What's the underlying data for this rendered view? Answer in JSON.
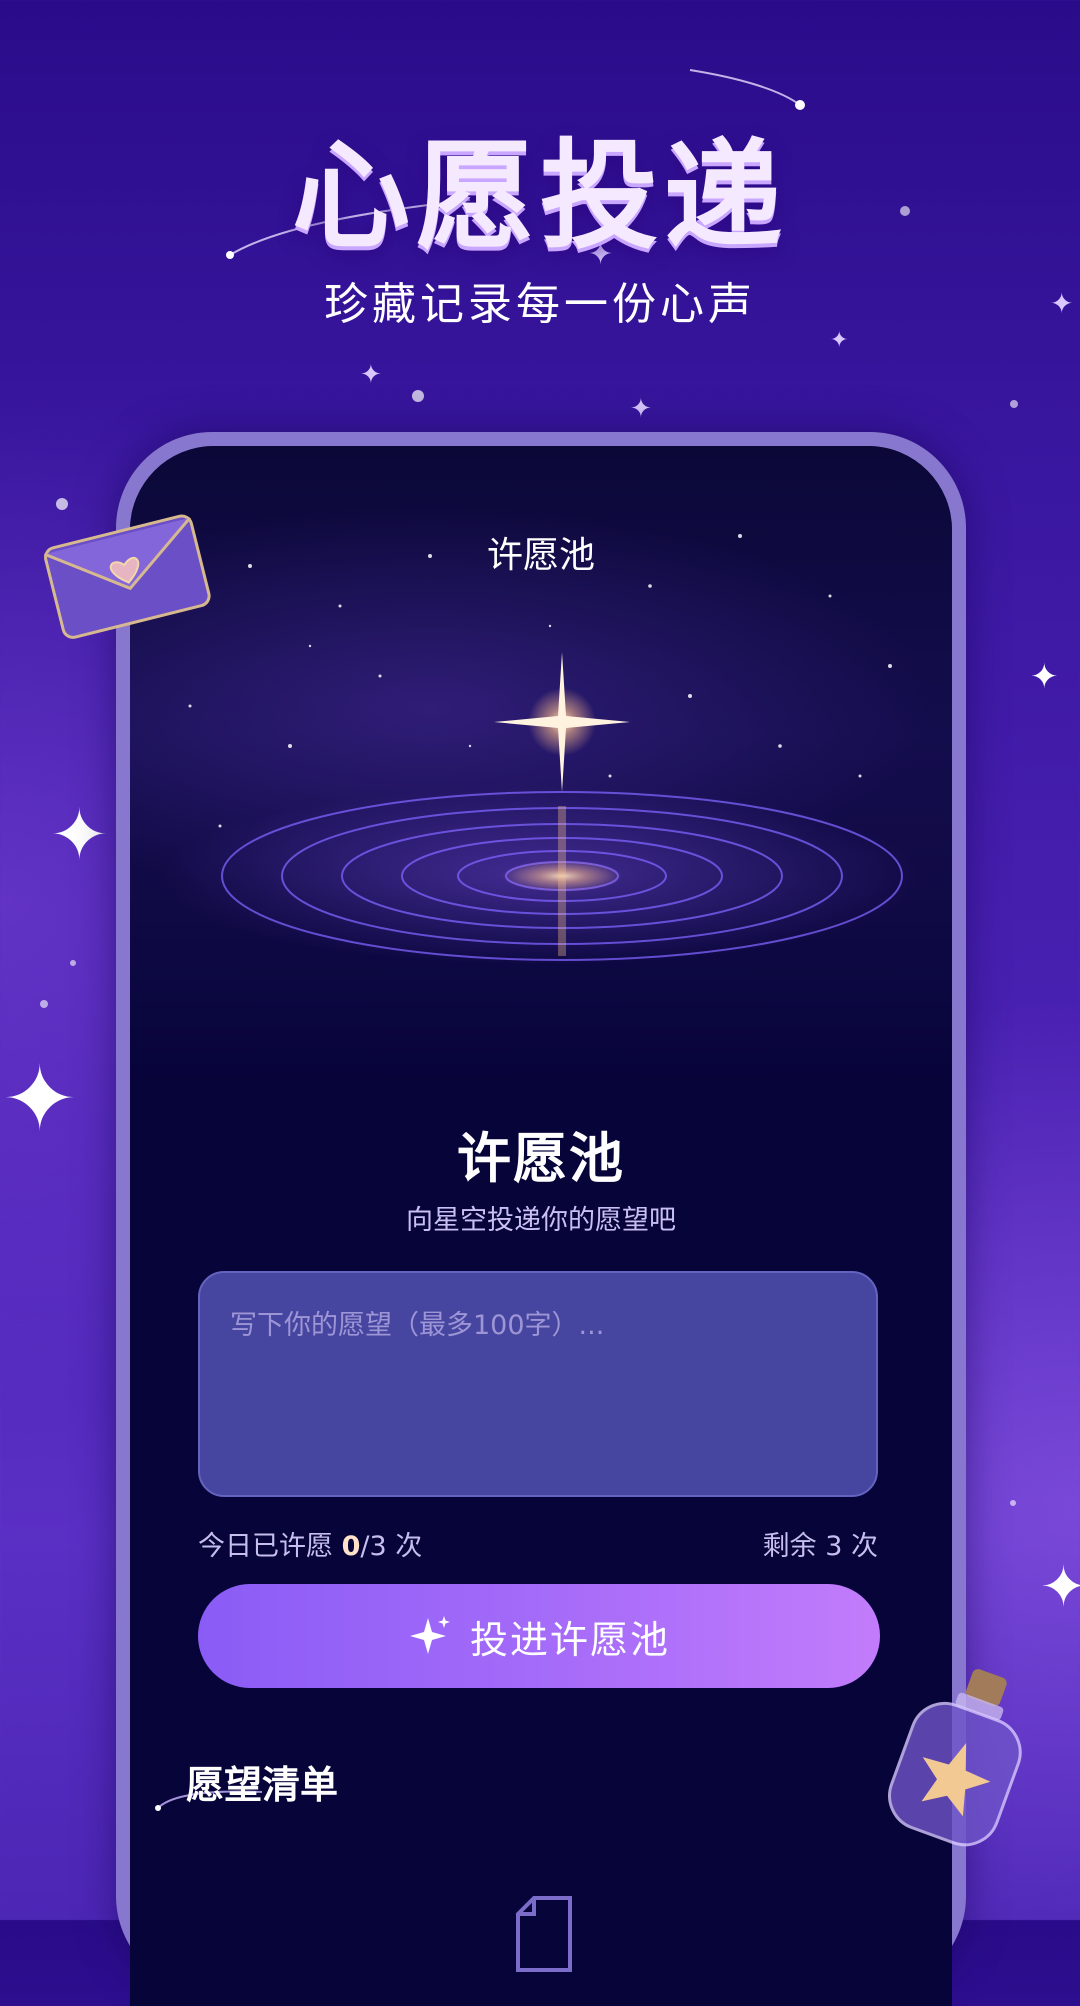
{
  "hero": {
    "title": "心愿投递",
    "subtitle": "珍藏记录每一份心声"
  },
  "screen": {
    "nav_title": "许愿池",
    "pool_title": "许愿池",
    "pool_subtitle": "向星空投递你的愿望吧",
    "wish_input": {
      "value": "",
      "placeholder": "写下你的愿望（最多100字）..."
    },
    "count": {
      "prefix": "今日已许愿 ",
      "used": "0",
      "suffix": "/3 次",
      "remaining": "剩余 3 次"
    },
    "submit_label": "投进许愿池",
    "wish_list_title": "愿望清单"
  },
  "colors": {
    "background": "#3a17a0",
    "screen_bg": "#07043a",
    "input_bg": "#4646a0",
    "button_start": "#8a5cf6",
    "button_end": "#c27cfb",
    "accent_number": "#ffe2c7"
  },
  "icons": {
    "button": "sparkle-icon",
    "hero_left": "envelope-heart-icon",
    "hero_right": "star-bottle-icon",
    "list": "document-icon"
  }
}
